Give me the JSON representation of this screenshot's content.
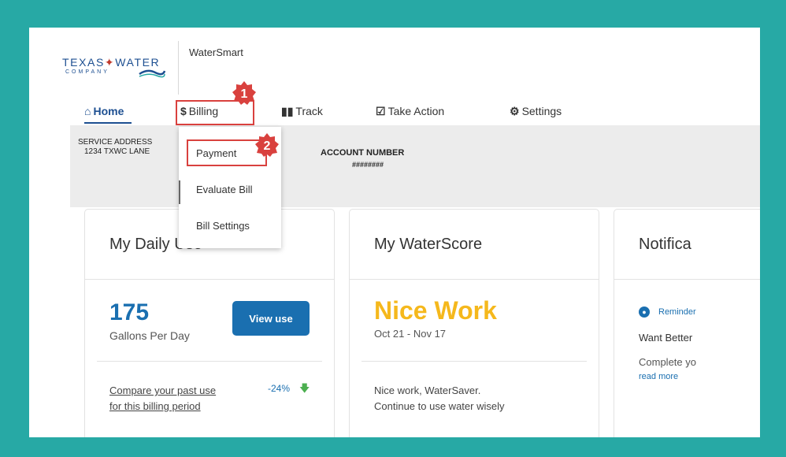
{
  "header": {
    "logo_line1_a": "TEXAS",
    "logo_line1_b": "WATER",
    "logo_line2": "COMPANY",
    "app_name": "WaterSmart"
  },
  "nav": {
    "home": "Home",
    "billing": "Billing",
    "track": "Track",
    "take_action": "Take Action",
    "settings": "Settings"
  },
  "account": {
    "service_address_label": "SERVICE ADDRESS",
    "service_address_value": "1234 TXWC LANE",
    "account_number_label": "ACCOUNT NUMBER",
    "account_number_value": "########"
  },
  "billing_menu": {
    "items": [
      "Payment",
      "Evaluate Bill",
      "Bill Settings"
    ]
  },
  "cards": {
    "daily_use": {
      "title": "My Daily Use",
      "value": "175",
      "unit": "Gallons Per Day",
      "button": "View use",
      "compare_line1": "Compare your past use",
      "compare_line2": "for this billing period",
      "change": "-24%"
    },
    "waterscore": {
      "title": "My WaterScore",
      "headline": "Nice Work",
      "range": "Oct 21 - Nov 17",
      "text_line1": "Nice work, WaterSaver.",
      "text_line2": "Continue to use water wisely"
    },
    "notifications": {
      "title": "Notifica",
      "reminder": "Reminder",
      "heading": "Want Better",
      "body": "Complete yo",
      "link": "read more"
    }
  },
  "callouts": {
    "step1": "1",
    "step2": "2",
    "color": "#d9413e"
  },
  "colors": {
    "brand": "#1d4f91",
    "accent_blue": "#1a6fb0",
    "score_yellow": "#f5b81c",
    "frame_teal": "#27a9a5"
  }
}
